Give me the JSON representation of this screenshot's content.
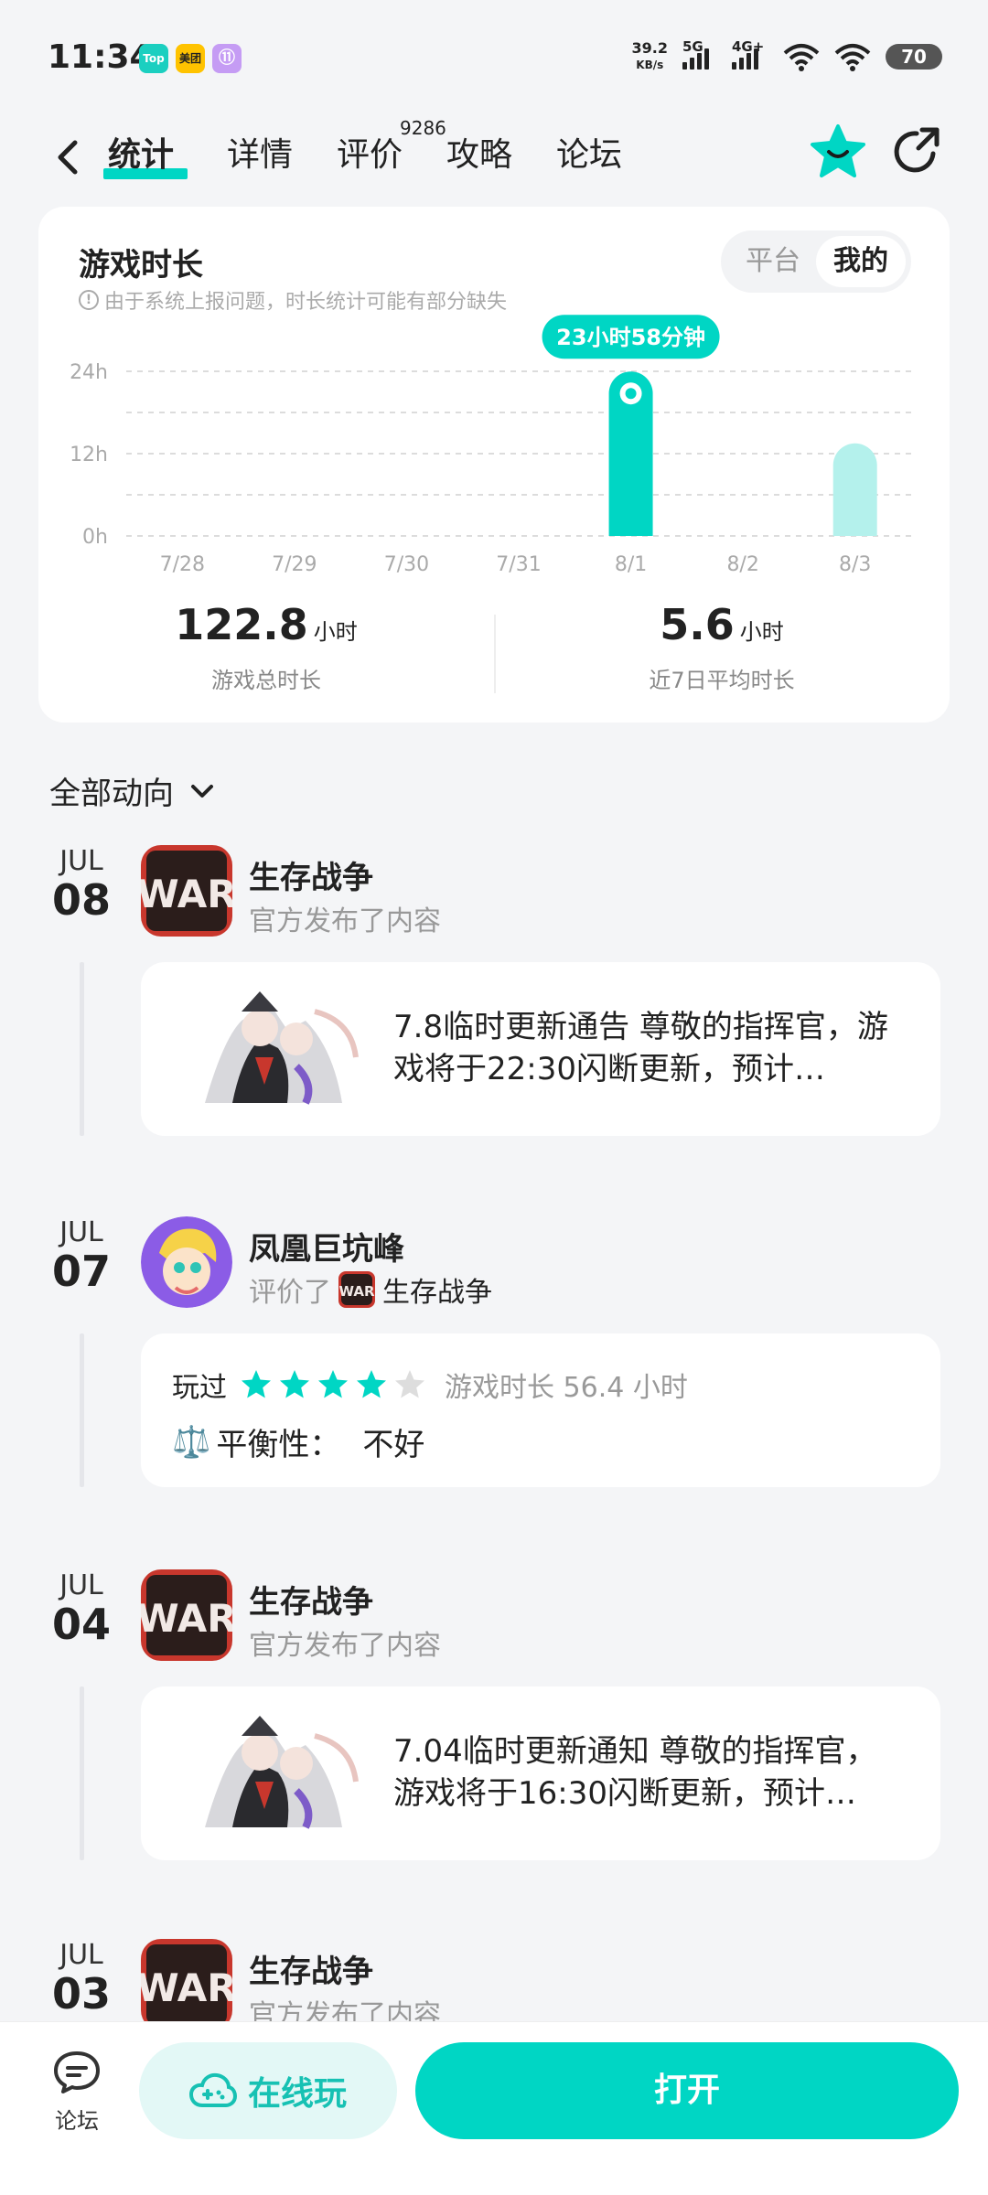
{
  "status_bar": {
    "time": "11:34",
    "app_icons": [
      {
        "name": "taptap-icon",
        "label": "Top",
        "color": "#1bcfc0"
      },
      {
        "name": "meituan-icon",
        "label": "美团",
        "color": "#ffc300"
      },
      {
        "name": "app-purple-icon",
        "label": "⑪",
        "color": "#c59cf4"
      }
    ],
    "net_speed_value": "39.2",
    "net_speed_unit": "KB/s",
    "signal_5g": "5G",
    "signal_4g": "4G+",
    "battery": "70"
  },
  "nav": {
    "tabs": [
      {
        "label": "统计",
        "active": true
      },
      {
        "label": "详情",
        "active": false
      },
      {
        "label": "评价",
        "active": false
      },
      {
        "label": "攻略",
        "active": false
      },
      {
        "label": "论坛",
        "active": false
      }
    ],
    "review_count": "9286"
  },
  "stats": {
    "title": "游戏时长",
    "note": "由于系统上报问题，时长统计可能有部分缺失",
    "segment": {
      "platform": "平台",
      "mine": "我的"
    },
    "total_value": "122.8",
    "total_unit": "小时",
    "total_label": "游戏总时长",
    "avg_value": "5.6",
    "avg_unit": "小时",
    "avg_label": "近7日平均时长"
  },
  "chart_data": {
    "type": "bar",
    "categories": [
      "7/28",
      "7/29",
      "7/30",
      "7/31",
      "8/1",
      "8/2",
      "8/3"
    ],
    "values": [
      0,
      0,
      0,
      0,
      23.97,
      0,
      13.5
    ],
    "y_ticks": [
      "24h",
      "12h",
      "0h"
    ],
    "ylim": [
      0,
      24
    ],
    "tooltip": "23小时58分钟",
    "highlight_index": 4,
    "colors": {
      "highlight": "#00d6c4",
      "normal": "#b4f1ec"
    }
  },
  "feed": {
    "filter_label": "全部动向",
    "entries": [
      {
        "month": "JUL",
        "day": "08",
        "title": "生存战争",
        "sub": "官方发布了内容",
        "post": "7.8临时更新通告 尊敬的指挥官，游戏将于22:30闪断更新，预计…"
      },
      {
        "month": "JUL",
        "day": "07",
        "title": "凤凰巨坑峰",
        "sub": "评价了",
        "game": "生存战争",
        "review_played": "玩过",
        "rating": 4,
        "playtime": "游戏时长 56.4 小时",
        "balance_icon": "⚖️",
        "balance_label": "平衡性：",
        "balance_value": "不好"
      },
      {
        "month": "JUL",
        "day": "04",
        "title": "生存战争",
        "sub": "官方发布了内容",
        "post": "7.04临时更新通知 尊敬的指挥官，游戏将于16:30闪断更新，预计…"
      },
      {
        "month": "JUL",
        "day": "03",
        "title": "生存战争",
        "sub": "官方发布了内容"
      }
    ]
  },
  "bottom": {
    "forum_label": "论坛",
    "cloud_play": "在线玩",
    "open": "打开"
  },
  "colors": {
    "accent": "#00d6c4",
    "accent_light": "#e3f8f6",
    "war_red": "#c8372d"
  }
}
